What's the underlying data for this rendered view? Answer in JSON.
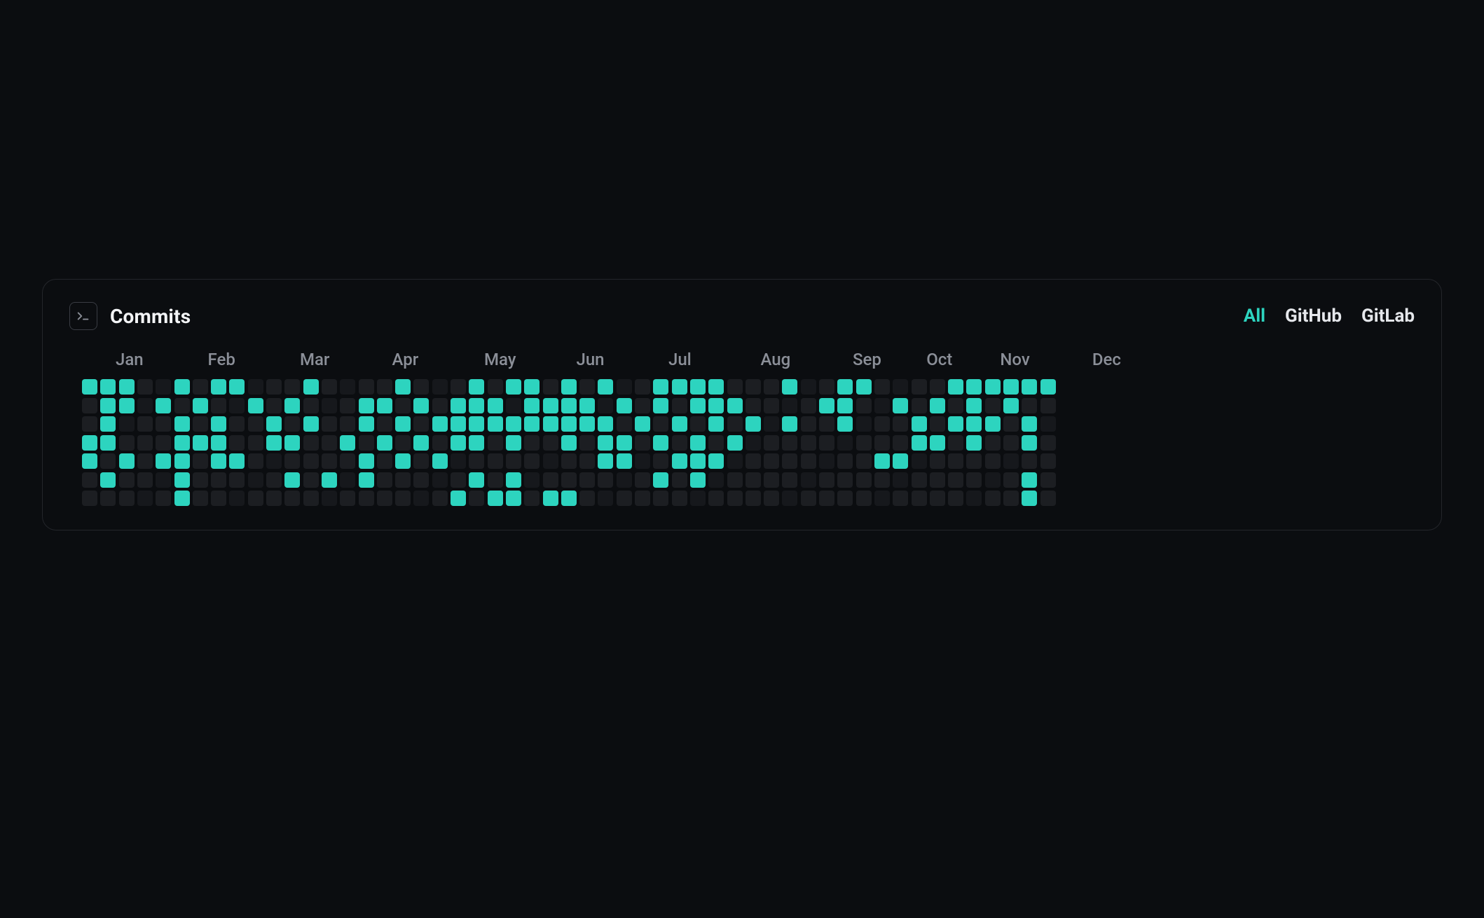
{
  "card": {
    "title": "Commits",
    "filters": [
      {
        "label": "All",
        "active": true
      },
      {
        "label": "GitHub",
        "active": false
      },
      {
        "label": "GitLab",
        "active": false
      }
    ]
  },
  "colors": {
    "accent": "#2dd4bf",
    "cell_off": "#1c1e22",
    "cell_dark": "#16181c"
  },
  "chart_data": {
    "type": "heatmap",
    "title": "Commits",
    "xlabel": "week",
    "ylabel": "day-of-week",
    "weeks": 53,
    "days": 7,
    "months": [
      {
        "label": "Jan",
        "week": 1
      },
      {
        "label": "Feb",
        "week": 6
      },
      {
        "label": "Mar",
        "week": 11
      },
      {
        "label": "Apr",
        "week": 16
      },
      {
        "label": "May",
        "week": 21
      },
      {
        "label": "Jun",
        "week": 26
      },
      {
        "label": "Jul",
        "week": 31
      },
      {
        "label": "Aug",
        "week": 36
      },
      {
        "label": "Sep",
        "week": 41
      },
      {
        "label": "Oct",
        "week": 45
      },
      {
        "label": "Nov",
        "week": 49
      },
      {
        "label": "Dec",
        "week": 54
      }
    ],
    "cells_on": [
      [
        1,
        0
      ],
      [
        2,
        0
      ],
      [
        3,
        0
      ],
      [
        2,
        1
      ],
      [
        3,
        1
      ],
      [
        2,
        2
      ],
      [
        1,
        3
      ],
      [
        2,
        3
      ],
      [
        1,
        4
      ],
      [
        3,
        4
      ],
      [
        2,
        5
      ],
      [
        5,
        1
      ],
      [
        5,
        4
      ],
      [
        6,
        0
      ],
      [
        6,
        2
      ],
      [
        6,
        3
      ],
      [
        6,
        4
      ],
      [
        6,
        5
      ],
      [
        6,
        6
      ],
      [
        7,
        1
      ],
      [
        7,
        3
      ],
      [
        8,
        0
      ],
      [
        8,
        2
      ],
      [
        8,
        3
      ],
      [
        8,
        4
      ],
      [
        9,
        0
      ],
      [
        9,
        4
      ],
      [
        10,
        1
      ],
      [
        11,
        2
      ],
      [
        11,
        3
      ],
      [
        12,
        1
      ],
      [
        12,
        3
      ],
      [
        12,
        5
      ],
      [
        13,
        0
      ],
      [
        13,
        2
      ],
      [
        14,
        5
      ],
      [
        15,
        3
      ],
      [
        16,
        1
      ],
      [
        16,
        2
      ],
      [
        16,
        4
      ],
      [
        16,
        5
      ],
      [
        17,
        1
      ],
      [
        17,
        3
      ],
      [
        18,
        0
      ],
      [
        18,
        2
      ],
      [
        18,
        4
      ],
      [
        19,
        1
      ],
      [
        19,
        3
      ],
      [
        20,
        2
      ],
      [
        20,
        4
      ],
      [
        21,
        1
      ],
      [
        21,
        2
      ],
      [
        21,
        3
      ],
      [
        21,
        6
      ],
      [
        22,
        0
      ],
      [
        22,
        1
      ],
      [
        22,
        2
      ],
      [
        22,
        3
      ],
      [
        22,
        5
      ],
      [
        23,
        1
      ],
      [
        23,
        2
      ],
      [
        23,
        6
      ],
      [
        24,
        0
      ],
      [
        24,
        2
      ],
      [
        24,
        3
      ],
      [
        24,
        5
      ],
      [
        24,
        6
      ],
      [
        25,
        0
      ],
      [
        25,
        1
      ],
      [
        25,
        2
      ],
      [
        26,
        1
      ],
      [
        26,
        2
      ],
      [
        26,
        6
      ],
      [
        27,
        0
      ],
      [
        27,
        1
      ],
      [
        27,
        2
      ],
      [
        27,
        3
      ],
      [
        27,
        6
      ],
      [
        28,
        1
      ],
      [
        28,
        2
      ],
      [
        29,
        0
      ],
      [
        29,
        2
      ],
      [
        29,
        3
      ],
      [
        29,
        4
      ],
      [
        30,
        1
      ],
      [
        30,
        3
      ],
      [
        30,
        4
      ],
      [
        31,
        2
      ],
      [
        32,
        0
      ],
      [
        32,
        1
      ],
      [
        32,
        3
      ],
      [
        32,
        5
      ],
      [
        33,
        0
      ],
      [
        33,
        2
      ],
      [
        33,
        4
      ],
      [
        34,
        0
      ],
      [
        34,
        1
      ],
      [
        34,
        3
      ],
      [
        34,
        4
      ],
      [
        34,
        5
      ],
      [
        35,
        0
      ],
      [
        35,
        1
      ],
      [
        35,
        2
      ],
      [
        35,
        4
      ],
      [
        36,
        1
      ],
      [
        36,
        3
      ],
      [
        37,
        2
      ],
      [
        39,
        0
      ],
      [
        39,
        2
      ],
      [
        41,
        1
      ],
      [
        42,
        0
      ],
      [
        42,
        1
      ],
      [
        42,
        2
      ],
      [
        43,
        0
      ],
      [
        44,
        4
      ],
      [
        45,
        1
      ],
      [
        45,
        4
      ],
      [
        46,
        2
      ],
      [
        46,
        3
      ],
      [
        47,
        1
      ],
      [
        47,
        3
      ],
      [
        48,
        0
      ],
      [
        48,
        2
      ],
      [
        49,
        0
      ],
      [
        49,
        1
      ],
      [
        49,
        2
      ],
      [
        49,
        3
      ],
      [
        50,
        0
      ],
      [
        50,
        2
      ],
      [
        51,
        0
      ],
      [
        51,
        1
      ],
      [
        52,
        0
      ],
      [
        52,
        2
      ],
      [
        52,
        3
      ],
      [
        52,
        5
      ],
      [
        52,
        6
      ],
      [
        53,
        0
      ]
    ]
  }
}
